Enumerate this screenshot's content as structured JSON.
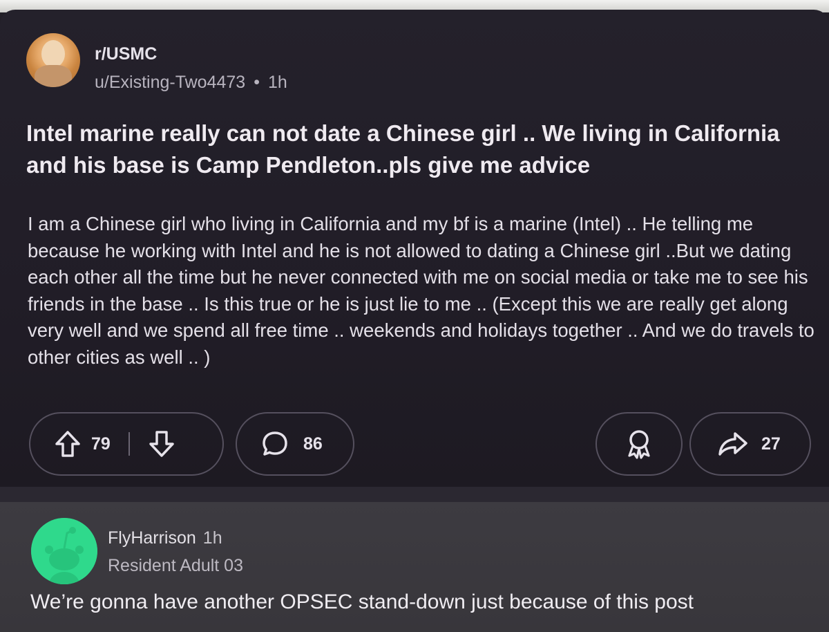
{
  "post": {
    "subreddit": "r/USMC",
    "author": "u/Existing-Two4473",
    "separator": "•",
    "age": "1h",
    "title": "Intel marine really can not date a Chinese girl .. We living in California and his base is Camp Pendleton..pls give me advice",
    "body": "I am a Chinese girl who living in California and my bf is a marine (Intel) .. He telling me because he working with Intel and he is not allowed to dating a Chinese girl ..But we dating each other all the time but he never connected with me on social media or take me to see his friends in the base .. Is this true or he is just lie to me .. (Except this we are really get along very well and we spend all free time .. weekends and holidays together .. And we do travels to other cities as well .. )",
    "actions": {
      "upvote_count": "79",
      "comment_count": "86",
      "share_count": "27"
    },
    "icons": {
      "upvote": "upvote-arrow-icon",
      "downvote": "downvote-arrow-icon",
      "comment": "speech-bubble-icon",
      "award": "award-ribbon-icon",
      "share": "share-arrow-icon"
    }
  },
  "comment": {
    "author": "FlyHarrison",
    "age": "1h",
    "flair": "Resident Adult 03",
    "text": "We’re gonna have another OPSEC stand-down just because of this post",
    "avatar_color": "#2fd98c"
  },
  "colors": {
    "post_background": "#221f27",
    "comment_background": "#3b393e",
    "text_primary": "#efeaf0",
    "text_secondary": "#b8b4bf"
  }
}
